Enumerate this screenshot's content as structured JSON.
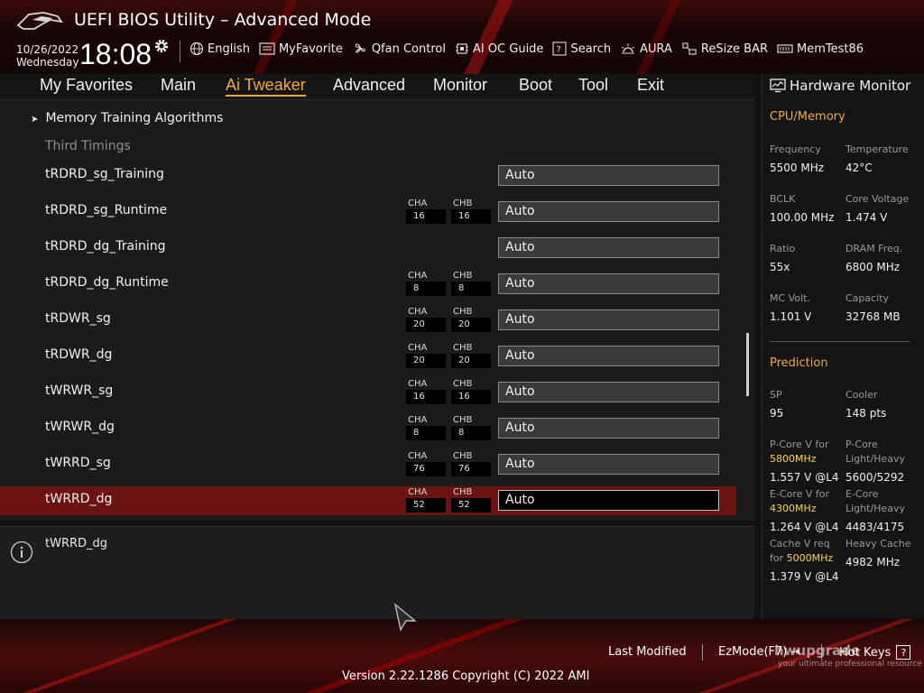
{
  "header": {
    "title": "UEFI BIOS Utility – Advanced Mode",
    "date": "10/26/2022",
    "day": "Wednesday",
    "time": "18:08",
    "toolbar": [
      {
        "label": "English",
        "icon": "globe-icon"
      },
      {
        "label": "MyFavorite",
        "icon": "favorite-icon"
      },
      {
        "label": "Qfan Control",
        "icon": "fan-icon"
      },
      {
        "label": "AI OC Guide",
        "icon": "ai-guide-icon"
      },
      {
        "label": "Search",
        "icon": "search-icon"
      },
      {
        "label": "AURA",
        "icon": "aura-icon"
      },
      {
        "label": "ReSize BAR",
        "icon": "resize-bar-icon"
      },
      {
        "label": "MemTest86",
        "icon": "memtest-icon"
      }
    ]
  },
  "nav": {
    "tabs": [
      "My Favorites",
      "Main",
      "Ai Tweaker",
      "Advanced",
      "Monitor",
      "Boot",
      "Tool",
      "Exit"
    ],
    "active": "Ai Tweaker"
  },
  "main": {
    "submenu": "Memory Training Algorithms",
    "section": "Third Timings",
    "rows": [
      {
        "label": "tRDRD_sg_Training",
        "cha": "",
        "chb": "",
        "value": "Auto"
      },
      {
        "label": "tRDRD_sg_Runtime",
        "cha": "16",
        "chb": "16",
        "value": "Auto"
      },
      {
        "label": "tRDRD_dg_Training",
        "cha": "",
        "chb": "",
        "value": "Auto"
      },
      {
        "label": "tRDRD_dg_Runtime",
        "cha": "8",
        "chb": "8",
        "value": "Auto"
      },
      {
        "label": "tRDWR_sg",
        "cha": "20",
        "chb": "20",
        "value": "Auto"
      },
      {
        "label": "tRDWR_dg",
        "cha": "20",
        "chb": "20",
        "value": "Auto"
      },
      {
        "label": "tWRWR_sg",
        "cha": "16",
        "chb": "16",
        "value": "Auto"
      },
      {
        "label": "tWRWR_dg",
        "cha": "8",
        "chb": "8",
        "value": "Auto"
      },
      {
        "label": "tWRRD_sg",
        "cha": "76",
        "chb": "76",
        "value": "Auto"
      },
      {
        "label": "tWRRD_dg",
        "cha": "52",
        "chb": "52",
        "value": "Auto"
      }
    ],
    "cha_label": "CHA",
    "chb_label": "CHB",
    "selected_row": "tWRRD_dg"
  },
  "info": {
    "text": "tWRRD_dg"
  },
  "hardware_monitor": {
    "title": "Hardware Monitor",
    "cpu_memory_title": "CPU/Memory",
    "cpu_memory": [
      {
        "label": "Frequency",
        "value": "5500 MHz"
      },
      {
        "label": "Temperature",
        "value": "42°C"
      },
      {
        "label": "BCLK",
        "value": "100.00 MHz"
      },
      {
        "label": "Core Voltage",
        "value": "1.474 V"
      },
      {
        "label": "Ratio",
        "value": "55x"
      },
      {
        "label": "DRAM Freq.",
        "value": "6800 MHz"
      },
      {
        "label": "MC Volt.",
        "value": "1.101 V"
      },
      {
        "label": "Capacity",
        "value": "32768 MB"
      }
    ],
    "prediction_title": "Prediction",
    "sp_label": "SP",
    "sp_value": "95",
    "cooler_label": "Cooler",
    "cooler_value": "148 pts",
    "pcore_v_label": "P-Core V for",
    "pcore_v_freq": "5800MHz",
    "pcore_v_value": "1.557 V @L4",
    "pcore_lh_label1": "P-Core",
    "pcore_lh_label2": "Light/Heavy",
    "pcore_lh_value": "5600/5292",
    "ecore_v_label": "E-Core V for",
    "ecore_v_freq": "4300MHz",
    "ecore_v_value": "1.264 V @L4",
    "ecore_lh_label1": "E-Core",
    "ecore_lh_label2": "Light/Heavy",
    "ecore_lh_value": "4483/4175",
    "cache_v_label1": "Cache V req",
    "cache_v_label2": "for",
    "cache_v_freq": "5000MHz",
    "cache_v_value": "1.379 V @L4",
    "heavy_cache_label": "Heavy Cache",
    "heavy_cache_value": "4982 MHz"
  },
  "footer": {
    "last_modified": "Last Modified",
    "ezmode": "EzMode(F7)",
    "hotkeys": "Hot Keys",
    "hotkeys_key": "?",
    "version": "Version 2.22.1286 Copyright (C) 2022 AMI",
    "watermark": "hwupgrade",
    "watermark_sub": "your ultimate professional resource"
  },
  "colors": {
    "accent": "#f2a93b",
    "selected_row": "#6b1212",
    "highlight_freq": "#ffd34d"
  }
}
